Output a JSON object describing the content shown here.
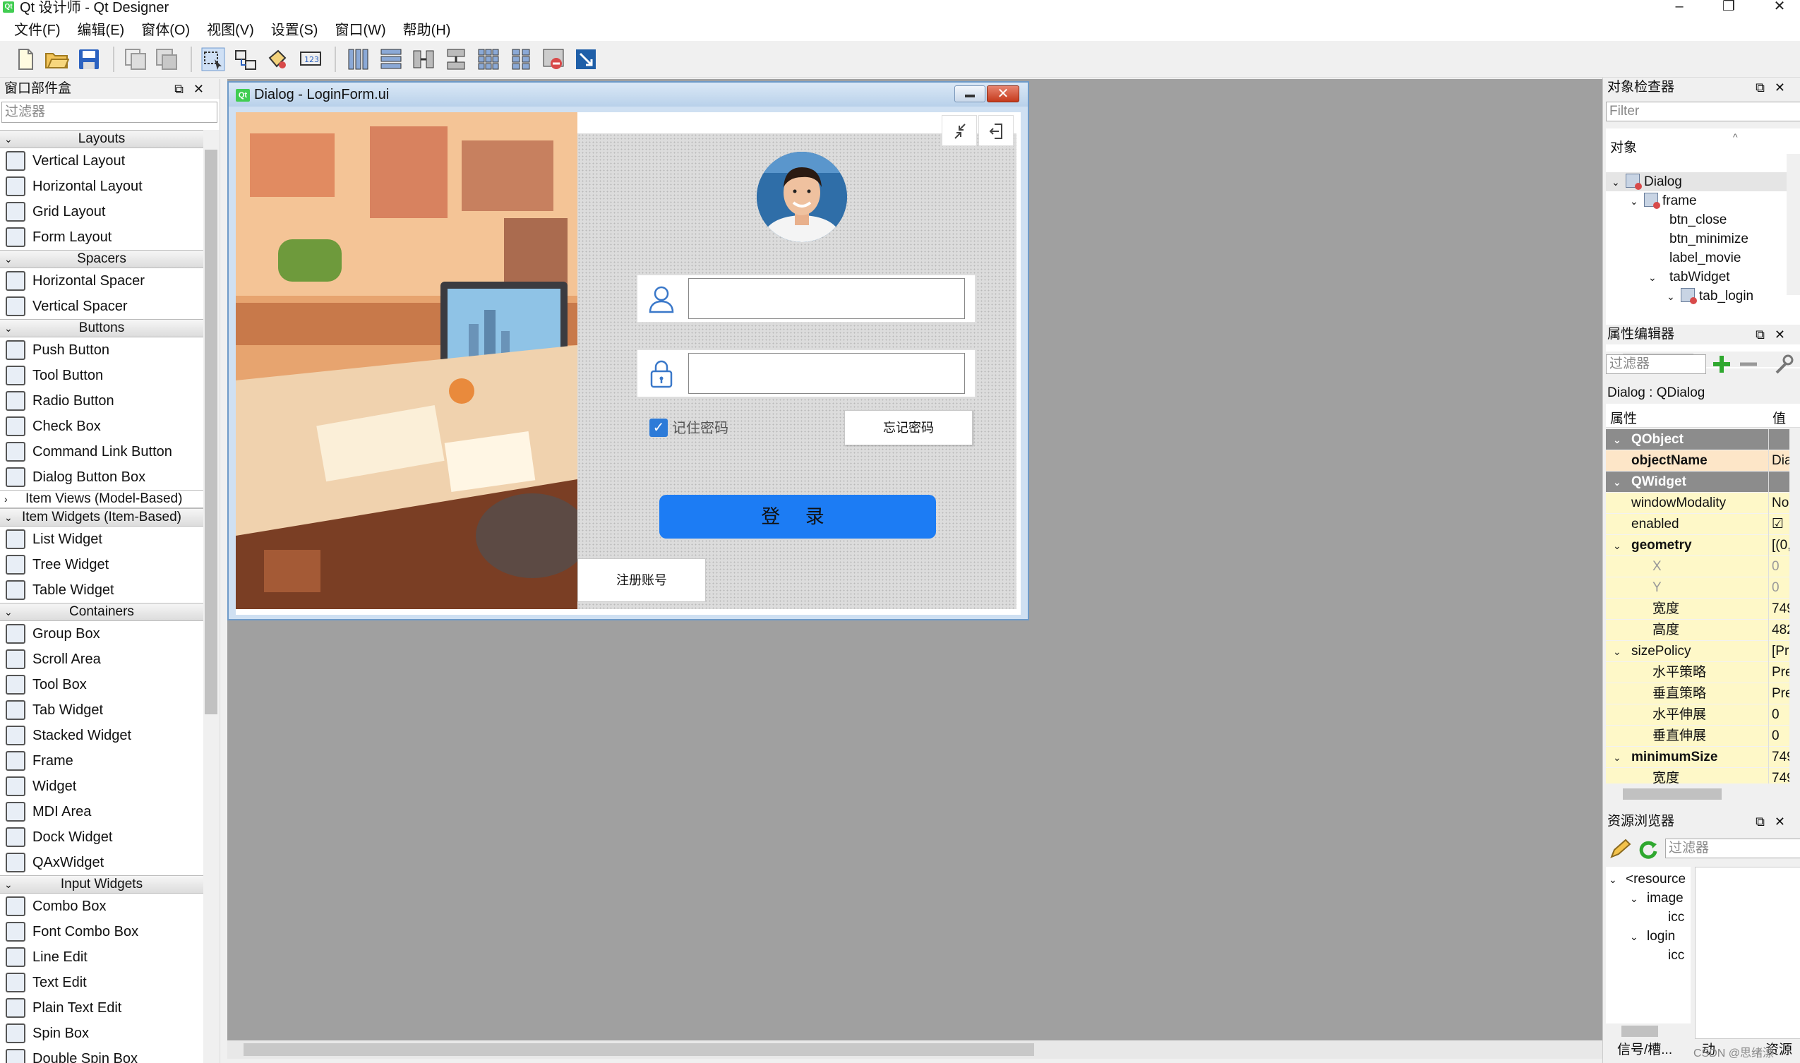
{
  "app": {
    "icon_text": "Qt",
    "title": "Qt 设计师 - Qt Designer",
    "window_buttons": {
      "minimize": "–",
      "restore": "❐",
      "close": "✕"
    }
  },
  "menu": [
    "文件(F)",
    "编辑(E)",
    "窗体(O)",
    "视图(V)",
    "设置(S)",
    "窗口(W)",
    "帮助(H)"
  ],
  "widget_box": {
    "title": "窗口部件盒",
    "filter_placeholder": "过滤器",
    "categories": [
      {
        "label": "Layouts",
        "items": [
          "Vertical Layout",
          "Horizontal Layout",
          "Grid Layout",
          "Form Layout"
        ]
      },
      {
        "label": "Spacers",
        "items": [
          "Horizontal Spacer",
          "Vertical Spacer"
        ]
      },
      {
        "label": "Buttons",
        "items": [
          "Push Button",
          "Tool Button",
          "Radio Button",
          "Check Box",
          "Command Link Button",
          "Dialog Button Box"
        ]
      },
      {
        "label": "Item Views (Model-Based)",
        "items": [],
        "collapsed": true
      },
      {
        "label": "Item Widgets (Item-Based)",
        "items": [
          "List Widget",
          "Tree Widget",
          "Table Widget"
        ]
      },
      {
        "label": "Containers",
        "items": [
          "Group Box",
          "Scroll Area",
          "Tool Box",
          "Tab Widget",
          "Stacked Widget",
          "Frame",
          "Widget",
          "MDI Area",
          "Dock Widget",
          "QAxWidget"
        ]
      },
      {
        "label": "Input Widgets",
        "items": [
          "Combo Box",
          "Font Combo Box",
          "Line Edit",
          "Text Edit",
          "Plain Text Edit",
          "Spin Box",
          "Double Spin Box"
        ]
      }
    ]
  },
  "dialog": {
    "icon_text": "Qt",
    "title": "Dialog - LoginForm.ui",
    "remember_label": "记住密码",
    "forget_label": "忘记密码",
    "login_label": "登 录",
    "register_label": "注册账号"
  },
  "object_inspector": {
    "title": "对象检查器",
    "filter_placeholder": "Filter",
    "header": "对象",
    "tree": [
      {
        "label": "Dialog",
        "depth": 0,
        "icon": true,
        "expanded": true,
        "selected": true
      },
      {
        "label": "frame",
        "depth": 1,
        "icon": true,
        "expanded": true
      },
      {
        "label": "btn_close",
        "depth": 2
      },
      {
        "label": "btn_minimize",
        "depth": 2
      },
      {
        "label": "label_movie",
        "depth": 2
      },
      {
        "label": "tabWidget",
        "depth": 2,
        "expanded": true
      },
      {
        "label": "tab_login",
        "depth": 3,
        "icon": true,
        "expanded": true
      }
    ]
  },
  "property_editor": {
    "title": "属性编辑器",
    "filter_placeholder": "过滤器",
    "context": "Dialog : QDialog",
    "col_property": "属性",
    "col_value": "值",
    "rows": [
      {
        "name": "QObject",
        "value": "",
        "kind": "group"
      },
      {
        "name": "objectName",
        "value": "Dia",
        "kind": "peach",
        "bold": true
      },
      {
        "name": "QWidget",
        "value": "",
        "kind": "group"
      },
      {
        "name": "windowModality",
        "value": "No",
        "kind": "yellow"
      },
      {
        "name": "enabled",
        "value": "☑",
        "kind": "yellow"
      },
      {
        "name": "geometry",
        "value": "[(0,",
        "kind": "yellow",
        "bold": true,
        "expandable": true
      },
      {
        "name": "X",
        "value": "0",
        "kind": "yellow",
        "indent": true,
        "dim": true
      },
      {
        "name": "Y",
        "value": "0",
        "kind": "yellow",
        "indent": true,
        "dim": true
      },
      {
        "name": "宽度",
        "value": "749",
        "kind": "yellow",
        "indent": true
      },
      {
        "name": "高度",
        "value": "482",
        "kind": "yellow",
        "indent": true
      },
      {
        "name": "sizePolicy",
        "value": "[Pre",
        "kind": "yellow",
        "expandable": true
      },
      {
        "name": "水平策略",
        "value": "Pre",
        "kind": "yellow",
        "indent": true
      },
      {
        "name": "垂直策略",
        "value": "Pre",
        "kind": "yellow",
        "indent": true
      },
      {
        "name": "水平伸展",
        "value": "0",
        "kind": "yellow",
        "indent": true
      },
      {
        "name": "垂直伸展",
        "value": "0",
        "kind": "yellow",
        "indent": true
      },
      {
        "name": "minimumSize",
        "value": "749",
        "kind": "yellow",
        "bold": true,
        "expandable": true
      },
      {
        "name": "宽度",
        "value": "749",
        "kind": "yellow",
        "indent": true
      }
    ]
  },
  "resource_browser": {
    "title": "资源浏览器",
    "filter_placeholder": "过滤器",
    "tree": [
      {
        "label": "<resource",
        "depth": 0,
        "expanded": true
      },
      {
        "label": "image",
        "depth": 1,
        "expanded": true
      },
      {
        "label": "icc",
        "depth": 2
      },
      {
        "label": "login",
        "depth": 1,
        "expanded": true
      },
      {
        "label": "icc",
        "depth": 2
      }
    ],
    "bottom_tabs": [
      "信号/槽...",
      "动",
      "资源"
    ],
    "watermark": "CSDN @思绪漂"
  }
}
